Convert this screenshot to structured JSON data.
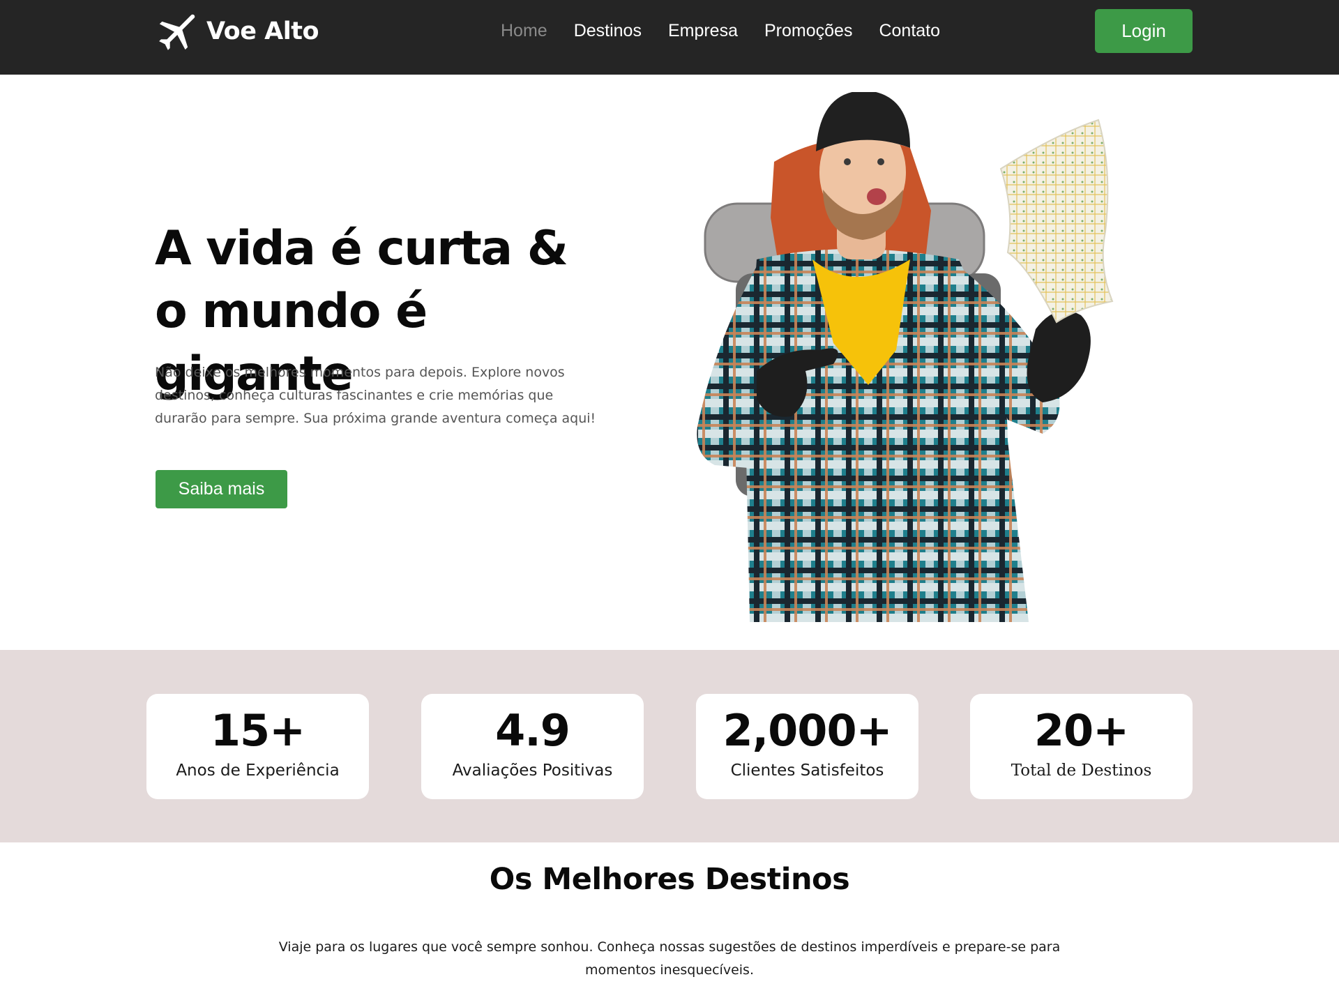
{
  "header": {
    "brand": "Voe Alto",
    "nav": [
      {
        "label": "Home",
        "active": true
      },
      {
        "label": "Destinos",
        "active": false
      },
      {
        "label": "Empresa",
        "active": false
      },
      {
        "label": "Promoções",
        "active": false
      },
      {
        "label": "Contato",
        "active": false
      }
    ],
    "login_label": "Login"
  },
  "hero": {
    "title": "A vida é curta & o mundo é gigante",
    "text": "Não deixe os melhores momentos para depois. Explore novos destinos, conheça culturas fascinantes e crie memórias que durarão para sempre. Sua próxima grande aventura começa aqui!",
    "cta_label": "Saiba mais",
    "image_subject": "backpacker-with-map"
  },
  "stats": [
    {
      "value": "15+",
      "label": "Anos de Experiência"
    },
    {
      "value": "4.9",
      "label": "Avaliações Positivas"
    },
    {
      "value": "2,000+",
      "label": "Clientes Satisfeitos"
    },
    {
      "value": "20+",
      "label": "Total de Destinos"
    }
  ],
  "destinations": {
    "title": "Os Melhores Destinos",
    "text": "Viaje para os lugares que você sempre sonhou. Conheça nossas sugestões de destinos imperdíveis e prepare-se para momentos inesquecíveis."
  },
  "colors": {
    "header_bg": "#252525",
    "accent_green": "#3d9a47",
    "stats_bg": "#e4dada",
    "nav_active": "#8a8a8a"
  },
  "icons": {
    "logo": "airplane-icon"
  }
}
